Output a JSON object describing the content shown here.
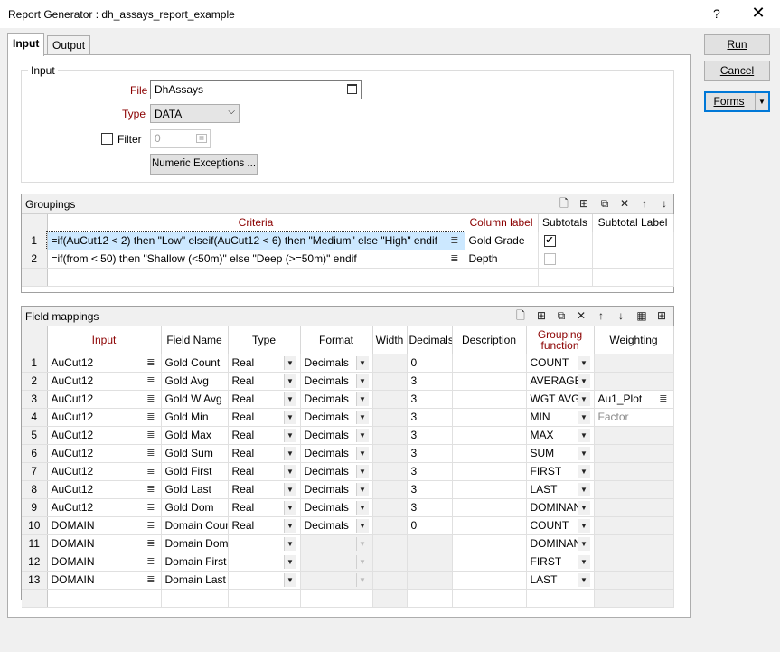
{
  "window": {
    "title": "Report Generator : dh_assays_report_example",
    "help": "?",
    "close": "✕"
  },
  "tabs": [
    {
      "label": "Input"
    },
    {
      "label": "Output"
    }
  ],
  "buttons": {
    "run": "Run",
    "cancel": "Cancel",
    "forms": "Forms"
  },
  "input_group": {
    "legend": "Input",
    "file_label": "File",
    "file_value": "DhAssays",
    "type_label": "Type",
    "type_value": "DATA",
    "filter_label": "Filter",
    "filter_value": "0",
    "numeric_exceptions": "Numeric Exceptions ..."
  },
  "groupings": {
    "title": "Groupings",
    "columns": [
      "Criteria",
      "Column label",
      "Subtotals",
      "Subtotal Label"
    ],
    "rows": [
      {
        "n": "1",
        "criteria": "=if(AuCut12 < 2) then \"Low\" elseif(AuCut12 < 6) then \"Medium\" else \"High\" endif",
        "label": "Gold Grade",
        "subtotal": true,
        "subtotal_label": ""
      },
      {
        "n": "2",
        "criteria": "=if(from < 50) then \"Shallow (<50m)\" else \"Deep (>=50m)\" endif",
        "label": "Depth",
        "subtotal": false,
        "subtotal_label": ""
      }
    ]
  },
  "field_mappings": {
    "title": "Field mappings",
    "columns": [
      "Input",
      "Field Name",
      "Type",
      "Format",
      "Width",
      "Decimals",
      "Description",
      "Grouping function",
      "Weighting"
    ],
    "rows": [
      {
        "n": "1",
        "input": "AuCut12",
        "field": "Gold Count",
        "type": "Real",
        "format": "Decimals",
        "width": "",
        "decimals": "0",
        "desc": "",
        "func": "COUNT",
        "weight": ""
      },
      {
        "n": "2",
        "input": "AuCut12",
        "field": "Gold Avg",
        "type": "Real",
        "format": "Decimals",
        "width": "",
        "decimals": "3",
        "desc": "",
        "func": "AVERAGE",
        "weight": ""
      },
      {
        "n": "3",
        "input": "AuCut12",
        "field": "Gold W Avg",
        "type": "Real",
        "format": "Decimals",
        "width": "",
        "decimals": "3",
        "desc": "",
        "func": "WGT AVG",
        "weight": "Au1_Plot"
      },
      {
        "n": "4",
        "input": "AuCut12",
        "field": "Gold Min",
        "type": "Real",
        "format": "Decimals",
        "width": "",
        "decimals": "3",
        "desc": "",
        "func": "MIN",
        "weight": "Factor"
      },
      {
        "n": "5",
        "input": "AuCut12",
        "field": "Gold Max",
        "type": "Real",
        "format": "Decimals",
        "width": "",
        "decimals": "3",
        "desc": "",
        "func": "MAX",
        "weight": ""
      },
      {
        "n": "6",
        "input": "AuCut12",
        "field": "Gold Sum",
        "type": "Real",
        "format": "Decimals",
        "width": "",
        "decimals": "3",
        "desc": "",
        "func": "SUM",
        "weight": ""
      },
      {
        "n": "7",
        "input": "AuCut12",
        "field": "Gold First",
        "type": "Real",
        "format": "Decimals",
        "width": "",
        "decimals": "3",
        "desc": "",
        "func": "FIRST",
        "weight": ""
      },
      {
        "n": "8",
        "input": "AuCut12",
        "field": "Gold Last",
        "type": "Real",
        "format": "Decimals",
        "width": "",
        "decimals": "3",
        "desc": "",
        "func": "LAST",
        "weight": ""
      },
      {
        "n": "9",
        "input": "AuCut12",
        "field": "Gold Dom",
        "type": "Real",
        "format": "Decimals",
        "width": "",
        "decimals": "3",
        "desc": "",
        "func": "DOMINAN",
        "weight": ""
      },
      {
        "n": "10",
        "input": "DOMAIN",
        "field": "Domain Cour",
        "type": "Real",
        "format": "Decimals",
        "width": "",
        "decimals": "0",
        "desc": "",
        "func": "COUNT",
        "weight": ""
      },
      {
        "n": "11",
        "input": "DOMAIN",
        "field": "Domain Dom",
        "type": "",
        "format": "",
        "width": "",
        "decimals": "",
        "desc": "",
        "func": "DOMINAN",
        "weight": ""
      },
      {
        "n": "12",
        "input": "DOMAIN",
        "field": "Domain First",
        "type": "",
        "format": "",
        "width": "",
        "decimals": "",
        "desc": "",
        "func": "FIRST",
        "weight": ""
      },
      {
        "n": "13",
        "input": "DOMAIN",
        "field": "Domain Last",
        "type": "",
        "format": "",
        "width": "",
        "decimals": "",
        "desc": "",
        "func": "LAST",
        "weight": ""
      }
    ]
  }
}
